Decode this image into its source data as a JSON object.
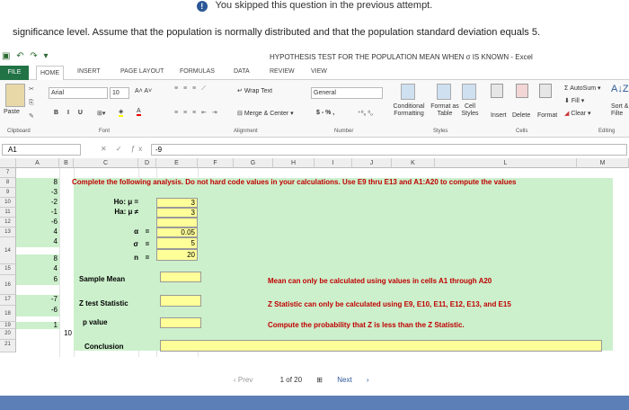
{
  "banner": "You skipped this question in the previous attempt.",
  "question": "significance level. Assume that the population is normally distributed and that the population standard deviation equals 5.",
  "window_title": "HYPOTHESIS TEST FOR THE POPULATION MEAN WHEN σ IS KNOWN - Excel",
  "tabs": [
    "FILE",
    "HOME",
    "INSERT",
    "PAGE LAYOUT",
    "FORMULAS",
    "DATA",
    "REVIEW",
    "VIEW"
  ],
  "ribbon": {
    "paste": "Paste",
    "font_name": "Arial",
    "font_size": "10",
    "wrap_text": "Wrap Text",
    "merge_center": "Merge & Center",
    "number_format": "General",
    "currency": "$ - % ,",
    "conditional": "Conditional Formatting",
    "format_table": "Format as Table",
    "cell_styles": "Cell Styles",
    "insert": "Insert",
    "delete": "Delete",
    "format": "Format",
    "autosum": "AutoSum",
    "fill": "Fill",
    "clear": "Clear",
    "sort": "Sort & Filte",
    "groups": {
      "clipboard": "Clipboard",
      "font": "Font",
      "alignment": "Alignment",
      "number": "Number",
      "styles": "Styles",
      "cells": "Cells",
      "editing": "Editing"
    }
  },
  "formula_bar": {
    "namebox": "A1",
    "value": "-9"
  },
  "columns": [
    "A",
    "B",
    "C",
    "D",
    "E",
    "F",
    "G",
    "H",
    "I",
    "J",
    "K",
    "L",
    "M"
  ],
  "rows": [
    "7",
    "8",
    "9",
    "10",
    "11",
    "12",
    "13",
    "14",
    "15",
    "16",
    "17",
    "18",
    "19",
    "20",
    "21"
  ],
  "column_a_values": [
    "8",
    "-3",
    "-2",
    "-1",
    "-6",
    "4",
    "4",
    "8",
    "4",
    "6",
    "-7",
    "-6",
    "1",
    "10"
  ],
  "instructions": "Complete the following analysis. Do not hard code values in your calculations. Use E9 thru E13 and A1:A20 to compute the values",
  "labels": {
    "ho": "Ho: μ =",
    "ha": "Ha: μ ≠",
    "alpha": "α",
    "sigma": "σ",
    "n": "n",
    "eq": "=",
    "sample_mean": "Sample Mean",
    "z_stat": "Z test Statistic",
    "p_value": "p value",
    "conclusion": "Conclusion"
  },
  "values": {
    "ho": "3",
    "ha": "3",
    "alpha": "0.05",
    "sigma": "5",
    "n": "20"
  },
  "notes": {
    "mean_note": "Mean can only be calculated using values in cells A1 through A20",
    "z_note": "Z Statistic can only be calculated using E9, E10, E11, E12, E13, and E15",
    "p_note": "Compute the probability that Z is less than the Z Statistic."
  },
  "pager": {
    "prev": "Prev",
    "page": "1 of 20",
    "next": "Next"
  }
}
